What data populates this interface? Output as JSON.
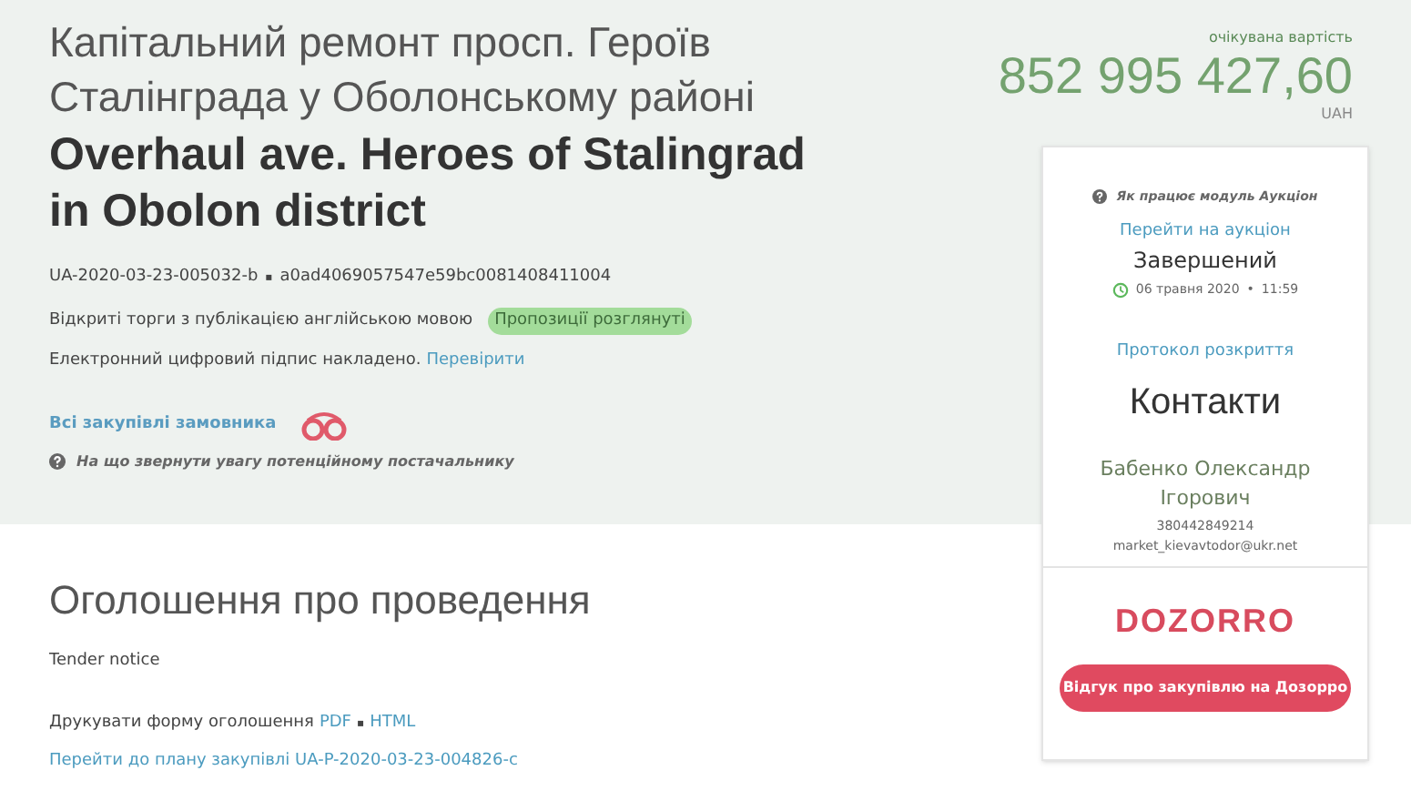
{
  "title_uk": "Капітальний ремонт просп. Героїв Сталінграда у Оболонському районі",
  "title_en": "Overhaul ave. Heroes of Stalingrad in Obolon district",
  "ids": {
    "tender_id": "UA-2020-03-23-005032-b",
    "separator": "▪",
    "hash": "a0ad4069057547e59bc0081408411004"
  },
  "procedure": {
    "text": "Відкриті торги з публікацією англійською мовою",
    "status_badge": "Пропозиції розглянуті"
  },
  "signature": {
    "text": "Електронний цифровий підпис накладено.",
    "link": "Перевірити"
  },
  "customer_link": "Всі закупівлі замовника",
  "hint": "На що звернути увагу потенційному постачальнику",
  "value": {
    "label": "очікувана вартість",
    "amount": "852 995 427,60",
    "currency": "UAH"
  },
  "auction": {
    "help": "Як працює модуль Аукціон",
    "link": "Перейти на аукціон",
    "status": "Завершений",
    "date": "06 травня 2020",
    "separator": "•",
    "time": "11:59"
  },
  "protocol_link": "Протокол розкриття",
  "contacts": {
    "title": "Контакти",
    "name": "Бабенко Олександр Ігорович",
    "phone": "380442849214",
    "email": "market_kievavtodor@ukr.net"
  },
  "dozorro": {
    "logo": "DOZORRO",
    "button": "Відгук про закупівлю на Дозорро"
  },
  "notice": {
    "title": "Оголошення про проведення",
    "subtitle": "Tender notice",
    "print_label": "Друкувати форму оголошення",
    "print_links": [
      "PDF",
      "HTML"
    ],
    "separator": "▪",
    "plan_link": "Перейти до плану закупівлі UA-P-2020-03-23-004826-c"
  }
}
